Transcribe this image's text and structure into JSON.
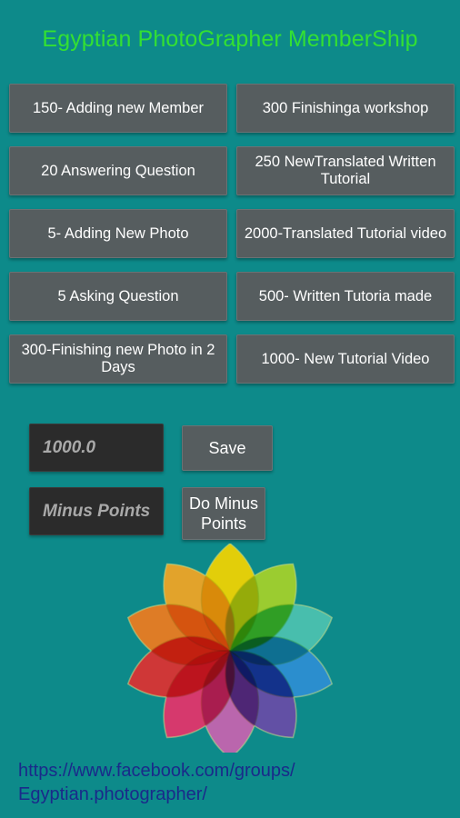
{
  "app": {
    "title": "Egyptian PhotoGrapher MemberShip",
    "background_color": "#0d8a8a",
    "title_color": "#33e033",
    "button_color": "#565d5f",
    "field_color": "#2b2b2b",
    "link_color": "#1a2a8a"
  },
  "points_grid": {
    "rows": [
      {
        "left": "150- Adding new Member",
        "right": "300 Finishinga workshop"
      },
      {
        "left": "20 Answering Question",
        "right": "250 NewTranslated Written Tutorial"
      },
      {
        "left": "5- Adding New Photo",
        "right": "2000-Translated Tutorial video"
      },
      {
        "left": "5 Asking Question",
        "right": "500- Written Tutoria made"
      },
      {
        "left": "300-Finishing new Photo in 2 Days",
        "right": "1000- New Tutorial Video"
      }
    ]
  },
  "entry": {
    "points_value": "1000.0",
    "points_placeholder": "1000.0",
    "save_label": "Save",
    "minus_value": "",
    "minus_placeholder": "Minus Points",
    "do_minus_label": "Do Minus Points"
  },
  "logo": {
    "icon": "color-wheel-flower-icon",
    "petal_colors": [
      "#f5d400",
      "#a8d229",
      "#4db848",
      "#6fc6d8",
      "#2e8fd4",
      "#6a4ca8",
      "#c964b0",
      "#e8336b",
      "#e03030",
      "#f07b1e",
      "#f5a623"
    ]
  },
  "footer": {
    "url_line1": "https://www.facebook.com/groups/",
    "url_line2": "Egyptian.photographer/"
  }
}
